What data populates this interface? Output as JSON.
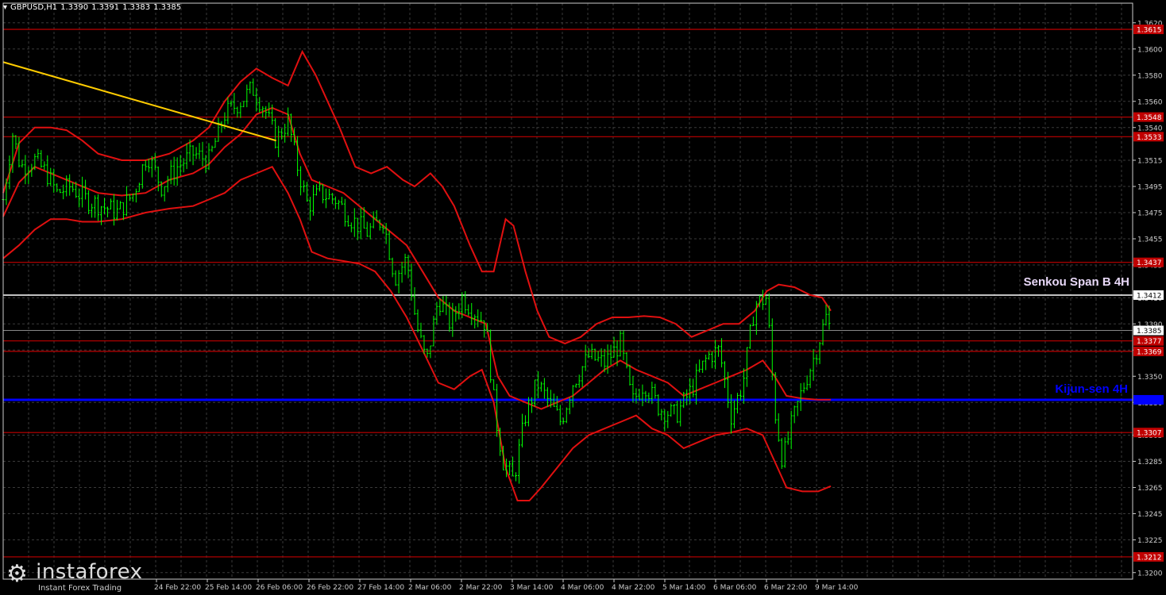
{
  "header": {
    "symbol": "GBPUSD,H1",
    "open": "1.3390",
    "high": "1.3391",
    "low": "1.3383",
    "close": "1.3385"
  },
  "watermark": {
    "brand": "instaforex",
    "tagline": "Instant Forex Trading"
  },
  "colors": {
    "background": "#000000",
    "grid": "#3a3a3a",
    "axis": "#cccccc",
    "candles": "#00ff00",
    "ichimoku": "#e01010",
    "levels": "#c00000",
    "kijun": "#0000ff",
    "senkou": "#ffffff",
    "trendline": "#ffcc00",
    "price_label": "#ffffff"
  },
  "chart_data": {
    "type": "line",
    "title": "GBPUSD,H1",
    "xlabel": "",
    "ylabel": "",
    "ylim": [
      1.3195,
      1.3635
    ],
    "y_ticks": [
      "1.3620",
      "1.3600",
      "1.3580",
      "1.3560",
      "1.3540",
      "1.3515",
      "1.3495",
      "1.3475",
      "1.3455",
      "1.3435",
      "1.3410",
      "1.3390",
      "1.3370",
      "1.3350",
      "1.3330",
      "1.3305",
      "1.3285",
      "1.3265",
      "1.3245",
      "1.3225",
      "1.3200"
    ],
    "x_ticks": [
      "24 Feb 22:00",
      "25 Feb 14:00",
      "26 Feb 06:00",
      "26 Feb 22:00",
      "27 Feb 14:00",
      "2 Mar 06:00",
      "2 Mar 22:00",
      "3 Mar 14:00",
      "4 Mar 06:00",
      "4 Mar 22:00",
      "5 Mar 14:00",
      "6 Mar 06:00",
      "6 Mar 22:00",
      "9 Mar 14:00"
    ],
    "levels": [
      {
        "label": "1.3615",
        "value": 1.3615
      },
      {
        "label": "1.3548",
        "value": 1.3548
      },
      {
        "label": "1.3533",
        "value": 1.3533
      },
      {
        "label": "1.3437",
        "value": 1.3437
      },
      {
        "label": "1.3377",
        "value": 1.3377
      },
      {
        "label": "1.3369",
        "value": 1.3369
      },
      {
        "label": "1.3307",
        "value": 1.3307
      },
      {
        "label": "1.3212",
        "value": 1.3212
      }
    ],
    "senkou_span_b": {
      "name": "Senkou Span B 4H",
      "label": "1.3412",
      "value": 1.3412
    },
    "kijun_sen": {
      "name": "Kijun-sen 4H",
      "value": 1.3332
    },
    "current_price": {
      "label": "1.3385",
      "value": 1.3385
    },
    "price_path": [
      [
        0,
        1.3485
      ],
      [
        12,
        1.3535
      ],
      [
        22,
        1.351
      ],
      [
        40,
        1.3515
      ],
      [
        55,
        1.3505
      ],
      [
        68,
        1.349
      ],
      [
        85,
        1.3495
      ],
      [
        105,
        1.3485
      ],
      [
        125,
        1.348
      ],
      [
        145,
        1.3475
      ],
      [
        165,
        1.349
      ],
      [
        182,
        1.352
      ],
      [
        200,
        1.3495
      ],
      [
        220,
        1.351
      ],
      [
        240,
        1.352
      ],
      [
        260,
        1.3515
      ],
      [
        280,
        1.355
      ],
      [
        300,
        1.356
      ],
      [
        315,
        1.357
      ],
      [
        330,
        1.3555
      ],
      [
        345,
        1.353
      ],
      [
        360,
        1.3545
      ],
      [
        372,
        1.351
      ],
      [
        385,
        1.348
      ],
      [
        400,
        1.349
      ],
      [
        420,
        1.3485
      ],
      [
        440,
        1.347
      ],
      [
        460,
        1.346
      ],
      [
        480,
        1.347
      ],
      [
        495,
        1.3425
      ],
      [
        510,
        1.344
      ],
      [
        522,
        1.339
      ],
      [
        535,
        1.336
      ],
      [
        550,
        1.341
      ],
      [
        565,
        1.339
      ],
      [
        580,
        1.341
      ],
      [
        595,
        1.34
      ],
      [
        610,
        1.339
      ],
      [
        622,
        1.332
      ],
      [
        632,
        1.3285
      ],
      [
        645,
        1.327
      ],
      [
        660,
        1.332
      ],
      [
        675,
        1.3345
      ],
      [
        690,
        1.333
      ],
      [
        705,
        1.3315
      ],
      [
        720,
        1.3345
      ],
      [
        740,
        1.3365
      ],
      [
        760,
        1.336
      ],
      [
        780,
        1.3375
      ],
      [
        795,
        1.333
      ],
      [
        810,
        1.3345
      ],
      [
        830,
        1.3325
      ],
      [
        850,
        1.332
      ],
      [
        870,
        1.334
      ],
      [
        890,
        1.3365
      ],
      [
        905,
        1.337
      ],
      [
        920,
        1.332
      ],
      [
        935,
        1.3345
      ],
      [
        950,
        1.3405
      ],
      [
        965,
        1.341
      ],
      [
        975,
        1.3325
      ],
      [
        985,
        1.3285
      ],
      [
        995,
        1.331
      ],
      [
        1010,
        1.334
      ],
      [
        1025,
        1.3365
      ],
      [
        1040,
        1.3395
      ],
      [
        1046,
        1.3385
      ]
    ],
    "kijun_line": [
      [
        0,
        1.3472
      ],
      [
        20,
        1.3498
      ],
      [
        40,
        1.351
      ],
      [
        60,
        1.3505
      ],
      [
        80,
        1.35
      ],
      [
        100,
        1.3495
      ],
      [
        120,
        1.349
      ],
      [
        150,
        1.3488
      ],
      [
        180,
        1.349
      ],
      [
        210,
        1.35
      ],
      [
        240,
        1.3505
      ],
      [
        260,
        1.3512
      ],
      [
        280,
        1.3525
      ],
      [
        300,
        1.3535
      ],
      [
        320,
        1.355
      ],
      [
        340,
        1.3555
      ],
      [
        360,
        1.355
      ],
      [
        375,
        1.352
      ],
      [
        390,
        1.35
      ],
      [
        410,
        1.3495
      ],
      [
        430,
        1.349
      ],
      [
        450,
        1.348
      ],
      [
        470,
        1.347
      ],
      [
        490,
        1.346
      ],
      [
        510,
        1.345
      ],
      [
        530,
        1.343
      ],
      [
        550,
        1.341
      ],
      [
        570,
        1.34
      ],
      [
        590,
        1.3395
      ],
      [
        610,
        1.339
      ],
      [
        625,
        1.335
      ],
      [
        640,
        1.3335
      ],
      [
        660,
        1.333
      ],
      [
        680,
        1.3325
      ],
      [
        700,
        1.333
      ],
      [
        720,
        1.3335
      ],
      [
        740,
        1.3345
      ],
      [
        760,
        1.3355
      ],
      [
        780,
        1.3362
      ],
      [
        800,
        1.3355
      ],
      [
        820,
        1.335
      ],
      [
        840,
        1.3345
      ],
      [
        860,
        1.3335
      ],
      [
        880,
        1.334
      ],
      [
        900,
        1.3345
      ],
      [
        920,
        1.335
      ],
      [
        940,
        1.3355
      ],
      [
        960,
        1.3362
      ],
      [
        975,
        1.335
      ],
      [
        990,
        1.3335
      ],
      [
        1010,
        1.3333
      ],
      [
        1030,
        1.3332
      ],
      [
        1046,
        1.3332
      ]
    ],
    "upper_band": [
      [
        0,
        1.349
      ],
      [
        20,
        1.3528
      ],
      [
        40,
        1.354
      ],
      [
        60,
        1.354
      ],
      [
        80,
        1.3538
      ],
      [
        100,
        1.353
      ],
      [
        120,
        1.352
      ],
      [
        150,
        1.3515
      ],
      [
        180,
        1.3515
      ],
      [
        210,
        1.352
      ],
      [
        240,
        1.353
      ],
      [
        260,
        1.354
      ],
      [
        280,
        1.356
      ],
      [
        300,
        1.3575
      ],
      [
        320,
        1.3585
      ],
      [
        340,
        1.3578
      ],
      [
        360,
        1.3572
      ],
      [
        378,
        1.3598
      ],
      [
        395,
        1.358
      ],
      [
        410,
        1.356
      ],
      [
        425,
        1.354
      ],
      [
        445,
        1.351
      ],
      [
        465,
        1.3505
      ],
      [
        485,
        1.351
      ],
      [
        505,
        1.35
      ],
      [
        520,
        1.3495
      ],
      [
        540,
        1.3505
      ],
      [
        555,
        1.3495
      ],
      [
        570,
        1.348
      ],
      [
        590,
        1.345
      ],
      [
        605,
        1.343
      ],
      [
        620,
        1.343
      ],
      [
        635,
        1.347
      ],
      [
        645,
        1.3465
      ],
      [
        660,
        1.343
      ],
      [
        675,
        1.34
      ],
      [
        690,
        1.338
      ],
      [
        710,
        1.3375
      ],
      [
        730,
        1.338
      ],
      [
        750,
        1.339
      ],
      [
        770,
        1.3395
      ],
      [
        790,
        1.3395
      ],
      [
        810,
        1.3396
      ],
      [
        830,
        1.3395
      ],
      [
        850,
        1.339
      ],
      [
        870,
        1.338
      ],
      [
        890,
        1.3385
      ],
      [
        910,
        1.339
      ],
      [
        930,
        1.339
      ],
      [
        950,
        1.34
      ],
      [
        965,
        1.3415
      ],
      [
        980,
        1.342
      ],
      [
        1000,
        1.3418
      ],
      [
        1020,
        1.3412
      ],
      [
        1035,
        1.341
      ],
      [
        1046,
        1.34
      ]
    ],
    "lower_band": [
      [
        0,
        1.344
      ],
      [
        20,
        1.345
      ],
      [
        40,
        1.3462
      ],
      [
        60,
        1.347
      ],
      [
        80,
        1.347
      ],
      [
        100,
        1.3468
      ],
      [
        120,
        1.3468
      ],
      [
        150,
        1.347
      ],
      [
        180,
        1.3475
      ],
      [
        210,
        1.3478
      ],
      [
        240,
        1.348
      ],
      [
        260,
        1.3485
      ],
      [
        280,
        1.349
      ],
      [
        300,
        1.35
      ],
      [
        320,
        1.3505
      ],
      [
        340,
        1.351
      ],
      [
        360,
        1.349
      ],
      [
        375,
        1.347
      ],
      [
        390,
        1.3445
      ],
      [
        410,
        1.344
      ],
      [
        430,
        1.3438
      ],
      [
        450,
        1.3436
      ],
      [
        470,
        1.343
      ],
      [
        490,
        1.3415
      ],
      [
        510,
        1.3395
      ],
      [
        530,
        1.337
      ],
      [
        550,
        1.3345
      ],
      [
        570,
        1.334
      ],
      [
        590,
        1.335
      ],
      [
        605,
        1.3355
      ],
      [
        620,
        1.333
      ],
      [
        635,
        1.328
      ],
      [
        650,
        1.3255
      ],
      [
        665,
        1.3255
      ],
      [
        680,
        1.3265
      ],
      [
        700,
        1.328
      ],
      [
        720,
        1.3295
      ],
      [
        740,
        1.3305
      ],
      [
        760,
        1.331
      ],
      [
        780,
        1.3315
      ],
      [
        800,
        1.332
      ],
      [
        820,
        1.331
      ],
      [
        840,
        1.3305
      ],
      [
        860,
        1.3295
      ],
      [
        880,
        1.33
      ],
      [
        900,
        1.3305
      ],
      [
        920,
        1.3307
      ],
      [
        940,
        1.331
      ],
      [
        960,
        1.3305
      ],
      [
        975,
        1.3285
      ],
      [
        990,
        1.3265
      ],
      [
        1010,
        1.3262
      ],
      [
        1030,
        1.3262
      ],
      [
        1046,
        1.3266
      ]
    ],
    "trendline": [
      [
        0,
        1.359
      ],
      [
        345,
        1.353
      ]
    ]
  }
}
